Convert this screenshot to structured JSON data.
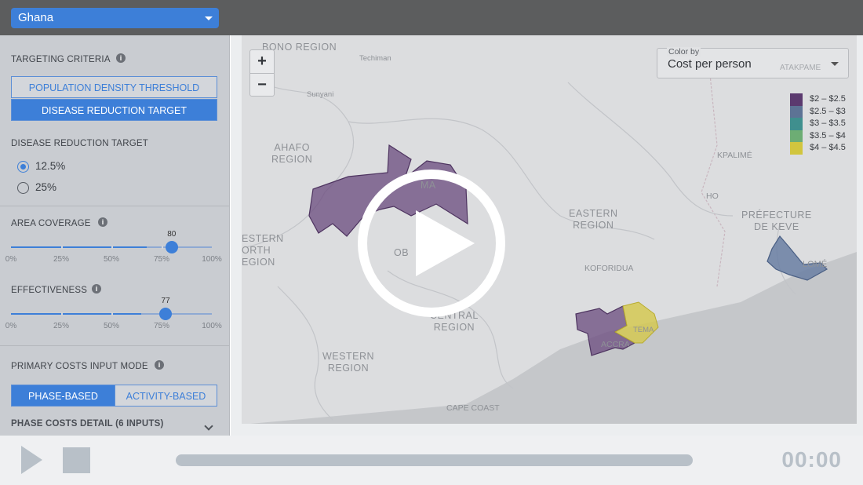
{
  "header": {
    "country": "Ghana"
  },
  "sidebar": {
    "targeting_title": "TARGETING CRITERIA",
    "targeting_options": [
      "POPULATION DENSITY THRESHOLD",
      "DISEASE REDUCTION TARGET"
    ],
    "targeting_selected": "DISEASE REDUCTION TARGET",
    "disease_title": "DISEASE REDUCTION TARGET",
    "disease_options": [
      "12.5%",
      "25%"
    ],
    "disease_selected": "12.5%",
    "area_coverage": {
      "title": "AREA COVERAGE",
      "value": "80",
      "fraction": 0.8,
      "labels": [
        "0%",
        "25%",
        "50%",
        "75%",
        "100%"
      ]
    },
    "effectiveness": {
      "title": "EFFECTIVENESS",
      "value": "77",
      "fraction": 0.77,
      "labels": [
        "0%",
        "25%",
        "50%",
        "75%",
        "100%"
      ]
    },
    "costs_title": "PRIMARY COSTS INPUT MODE",
    "cost_modes": [
      "PHASE-BASED",
      "ACTIVITY-BASED"
    ],
    "cost_mode_selected": "PHASE-BASED",
    "phase_detail": "PHASE COSTS DETAIL (6 INPUTS)",
    "info_glyph": "i"
  },
  "map": {
    "zoom_in": "+",
    "zoom_out": "−",
    "color_by_label": "Color by",
    "color_by_value": "Cost per person",
    "legend": [
      {
        "label": "$2 – $2.5",
        "color": "#5b3a6f"
      },
      {
        "label": "$2.5 – $3",
        "color": "#5d7395"
      },
      {
        "label": "$3 – $3.5",
        "color": "#3f8f8e"
      },
      {
        "label": "$3.5 – $4",
        "color": "#6dad74"
      },
      {
        "label": "$4 – $4.5",
        "color": "#d1c53e"
      }
    ],
    "region_labels": {
      "bono": "BONO REGION",
      "techiman": "Techiman",
      "sunyani": "Sunyani",
      "ahafo": "AHAFO\nREGION",
      "western_north": "ESTERN\nORTH\nEGION",
      "obuasi": "OB",
      "kumasi": "MA",
      "eastern": "EASTERN\nREGION",
      "koforidua": "KOFORIDUA",
      "central": "CENTRAL\nREGION",
      "western": "WESTERN\nREGION",
      "accra": "ACCRA",
      "tema": "TEMA",
      "cape_coast": "CAPE COAST",
      "kpalime": "KPALIMÉ",
      "ho": "HO",
      "prefecture": "PRÉFECTURE\nDE KEVE",
      "lome": "LOMÉ",
      "atakpame": "ATAKPAME"
    }
  },
  "player": {
    "time": "00:00",
    "progress": 0
  }
}
